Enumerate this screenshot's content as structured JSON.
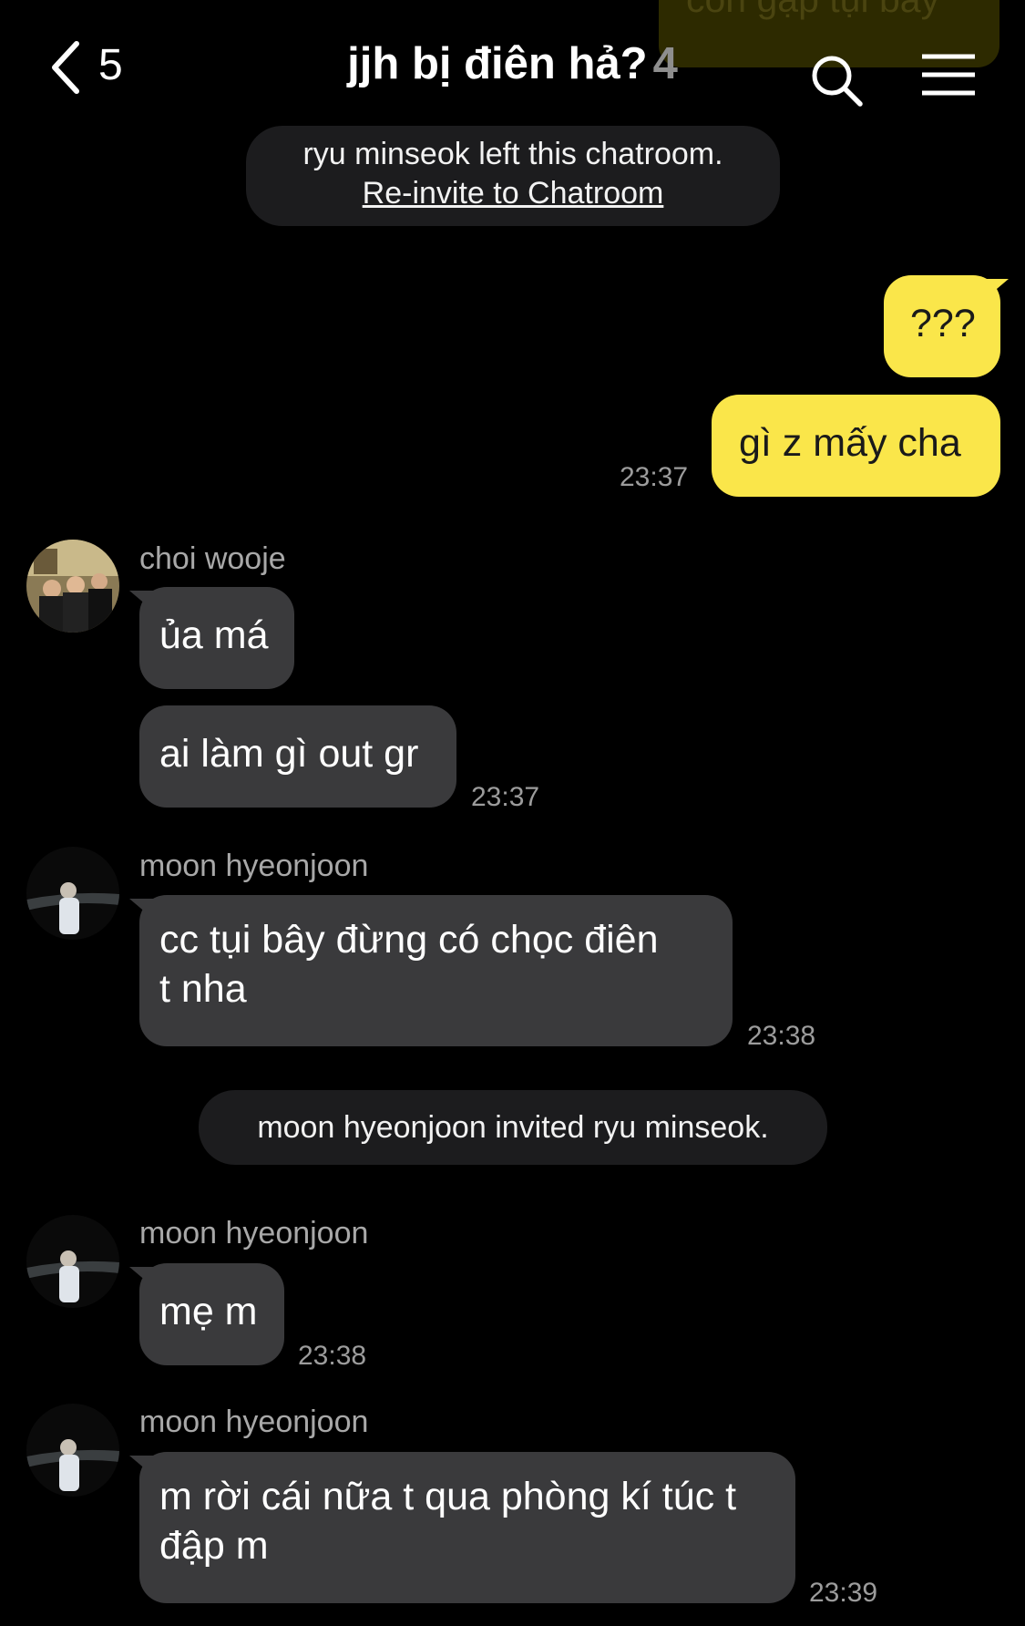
{
  "header": {
    "back_count": "5",
    "title": "jjh bị điên hả?",
    "member_count": "4",
    "partial_top_text": "còn gặp tụi bây"
  },
  "notices": {
    "left_line1": "ryu minseok left this chatroom.",
    "left_line2": "Re-invite to Chatroom",
    "invite": "moon hyeonjoon invited ryu minseok."
  },
  "messages": [
    {
      "from": "me",
      "text": "???"
    },
    {
      "from": "me",
      "text": "gì z mấy cha",
      "time": "23:37"
    },
    {
      "sender": "choi wooje",
      "text": "ủa má"
    },
    {
      "sender": "choi wooje",
      "text": "ai làm gì out gr",
      "time": "23:37"
    },
    {
      "sender": "moon hyeonjoon",
      "line1": "cc tụi bây đừng có chọc điên",
      "line2": "t nha",
      "time": "23:38"
    },
    {
      "sender": "moon hyeonjoon",
      "text": "mẹ m",
      "time": "23:38"
    },
    {
      "sender": "moon hyeonjoon",
      "line1": "m rời cái nữa t qua phòng kí túc t",
      "line2": "đập m",
      "time": "23:39"
    }
  ],
  "colors": {
    "my_bubble": "#fae64a",
    "their_bubble": "#3a3a3c",
    "background": "#000000"
  }
}
